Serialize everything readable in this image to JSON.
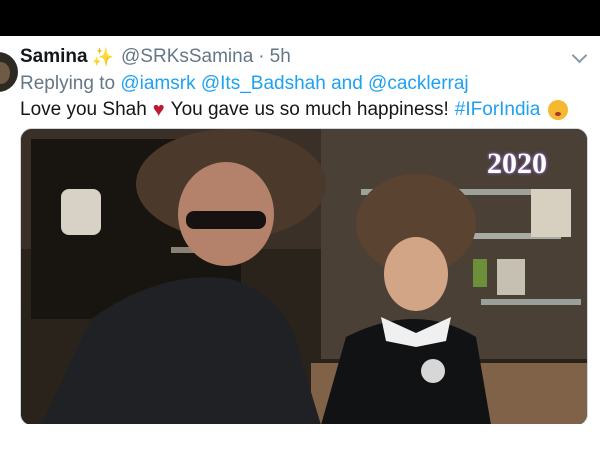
{
  "tweet": {
    "display_name": "Samina",
    "handle": "@SRKsSamina",
    "separator": "·",
    "time": "5h",
    "reply": {
      "prefix": "Replying to",
      "user1": "@iamsrk",
      "user2": "@Its_Badshah",
      "conjunction": "and",
      "user3": "@cacklerraj"
    },
    "text_part1": "Love you Shah",
    "text_part2": "You gave us so much happiness!",
    "hashtag": "#IForIndia",
    "icons": [
      "sparkles-icon",
      "red-heart-icon",
      "kiss-face-icon",
      "more-options-icon"
    ]
  },
  "media": {
    "overlay_text": "2020"
  },
  "colors": {
    "link": "#1da1f2",
    "secondary_text": "#657786",
    "primary_text": "#14171a",
    "heart": "#be1931"
  }
}
